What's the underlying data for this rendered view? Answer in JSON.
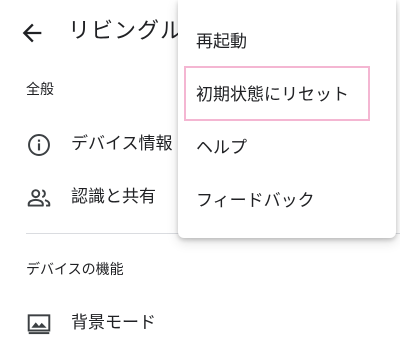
{
  "header": {
    "back_icon": "arrow-back-icon",
    "title": "リビングル"
  },
  "sections": {
    "general": {
      "title": "全般",
      "items": [
        {
          "label": "デバイス情報",
          "icon": "info-icon"
        },
        {
          "label": "認識と共有",
          "icon": "people-icon"
        }
      ]
    },
    "device_features": {
      "title": "デバイスの機能",
      "items": [
        {
          "label": "背景モード",
          "icon": "photo-frame-icon"
        }
      ]
    }
  },
  "menu": {
    "items": [
      {
        "label": "再起動"
      },
      {
        "label": "初期状態にリセット",
        "highlighted": true
      },
      {
        "label": "ヘルプ"
      },
      {
        "label": "フィードバック"
      }
    ]
  },
  "colors": {
    "text": "#202124",
    "divider": "#dadce0",
    "highlight_border": "#f4b6d2",
    "icon": "#3c4043"
  }
}
